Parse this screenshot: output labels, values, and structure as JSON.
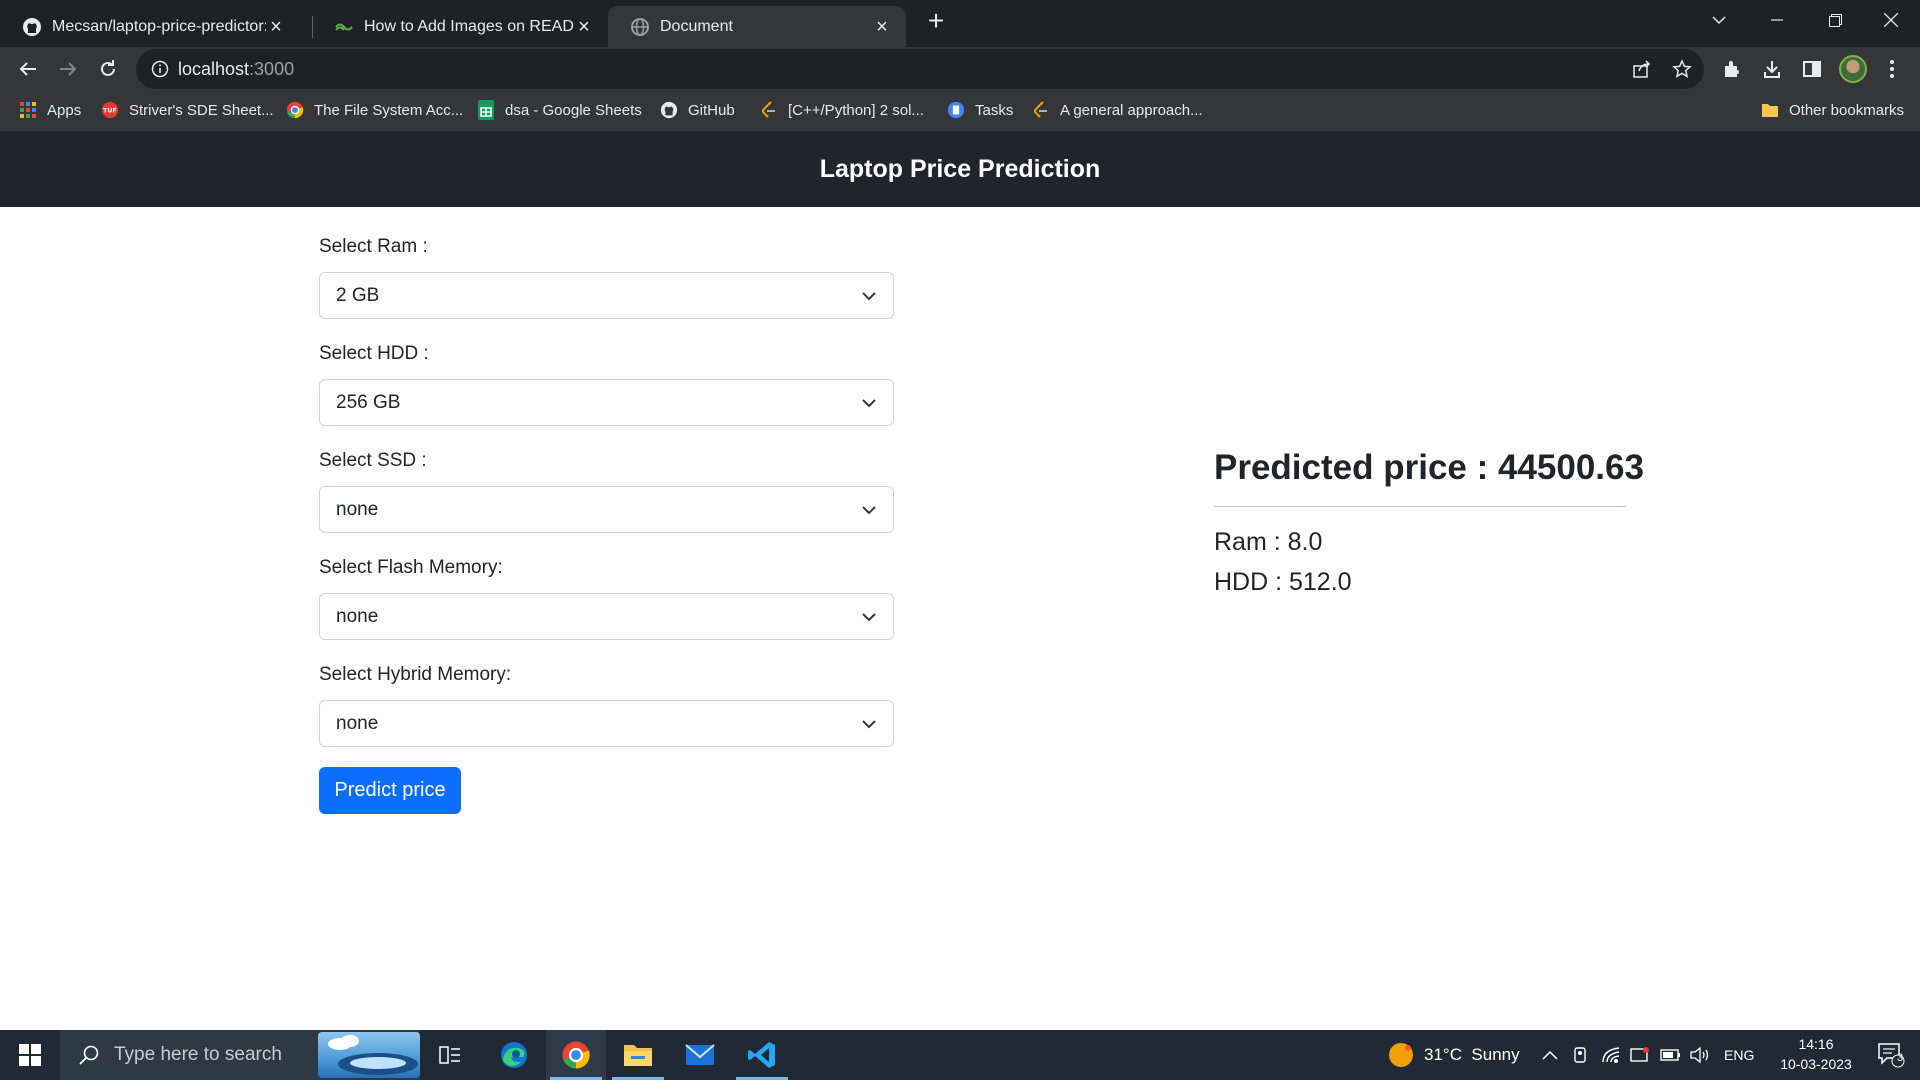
{
  "browser": {
    "tabs": [
      {
        "title": "Mecsan/laptop-price-predictor: M",
        "icon": "github-icon",
        "active": false
      },
      {
        "title": "How to Add Images on README",
        "icon": "link-icon",
        "active": false
      },
      {
        "title": "Document",
        "icon": "globe-icon",
        "active": true
      }
    ],
    "address": {
      "host": "localhost",
      "port": ":3000"
    },
    "bookmarks": [
      {
        "label": "Apps",
        "icon": "apps-grid-icon"
      },
      {
        "label": "Striver's SDE Sheet...",
        "icon": "tuf-icon"
      },
      {
        "label": "The File System Acc...",
        "icon": "chrome-icon"
      },
      {
        "label": "dsa - Google Sheets",
        "icon": "sheets-icon"
      },
      {
        "label": "GitHub",
        "icon": "github-icon"
      },
      {
        "label": "[C++/Python] 2 sol...",
        "icon": "leetcode-icon"
      },
      {
        "label": "Tasks",
        "icon": "tasks-icon"
      },
      {
        "label": "A general approach...",
        "icon": "leetcode-icon"
      },
      {
        "label": "Other bookmarks",
        "icon": "folder-icon"
      }
    ]
  },
  "page": {
    "title": "Laptop Price Prediction",
    "fields": [
      {
        "label": "Select Ram :",
        "value": "2 GB"
      },
      {
        "label": "Select HDD :",
        "value": "256 GB"
      },
      {
        "label": "Select SSD :",
        "value": "none"
      },
      {
        "label": "Select Flash Memory:",
        "value": "none"
      },
      {
        "label": "Select Hybrid Memory:",
        "value": "none"
      }
    ],
    "button_label": "Predict price",
    "result": {
      "heading": "Predicted price : 44500.63",
      "ram": "Ram : 8.0",
      "hdd": "HDD : 512.0"
    }
  },
  "taskbar": {
    "search_placeholder": "Type here to search",
    "weather": "31°C  Sunny",
    "language": "ENG",
    "time": "14:16",
    "date": "10-03-2023",
    "notification_count": "3"
  },
  "colors": {
    "navbar": "#212529",
    "primary_button": "#0d6efd",
    "chrome_dark": "#202124",
    "chrome_toolbar": "#35363a"
  }
}
